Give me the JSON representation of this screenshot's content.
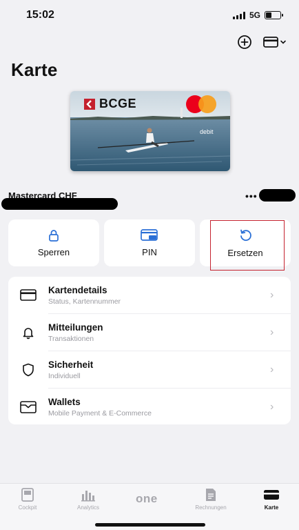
{
  "status": {
    "time": "15:02",
    "network": "5G"
  },
  "page": {
    "title": "Karte"
  },
  "card": {
    "bank_logo": "BCGE",
    "type_label": "debit",
    "name": "Mastercard CHF",
    "more": "•••"
  },
  "actions": [
    {
      "label": "Sperren",
      "icon": "lock-icon"
    },
    {
      "label": "PIN",
      "icon": "pin-card-icon"
    },
    {
      "label": "Ersetzen",
      "icon": "replace-icon"
    }
  ],
  "menu": [
    {
      "title": "Kartendetails",
      "subtitle": "Status, Kartennummer",
      "icon": "card-icon"
    },
    {
      "title": "Mitteilungen",
      "subtitle": "Transaktionen",
      "icon": "bell-icon"
    },
    {
      "title": "Sicherheit",
      "subtitle": "Individuell",
      "icon": "shield-icon"
    },
    {
      "title": "Wallets",
      "subtitle": "Mobile Payment & E-Commerce",
      "icon": "wallet-icon"
    }
  ],
  "tabs": [
    {
      "label": "Cockpit",
      "icon": "cockpit-icon"
    },
    {
      "label": "Analytics",
      "icon": "analytics-icon"
    },
    {
      "label": "one"
    },
    {
      "label": "Rechnungen",
      "icon": "invoice-icon"
    },
    {
      "label": "Karte",
      "icon": "card-tab-icon",
      "active": true
    }
  ],
  "colors": {
    "accent_red": "#c4202d",
    "background": "#f1f1f4",
    "icon_blue": "#2a6fd6"
  }
}
